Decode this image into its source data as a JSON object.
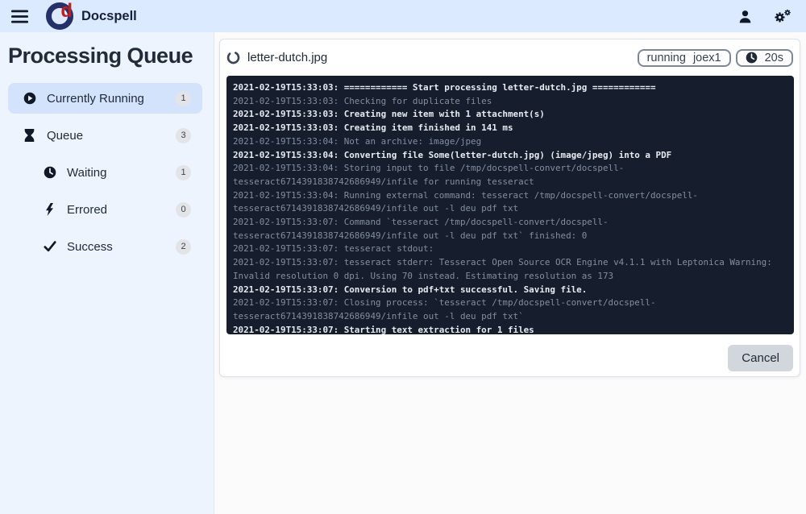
{
  "navbar": {
    "brand": "Docspell",
    "logo_letter": "d",
    "icons": [
      "menu-icon",
      "user-icon",
      "cogs-icon"
    ]
  },
  "sidebar": {
    "title": "Processing Queue",
    "items": [
      {
        "label": "Currently Running",
        "count": "1",
        "icon": "play-circle-icon",
        "active": true,
        "indent": false
      },
      {
        "label": "Queue",
        "count": "3",
        "icon": "hourglass-icon",
        "active": false,
        "indent": false
      },
      {
        "label": "Waiting",
        "count": "1",
        "icon": "clock-icon",
        "active": false,
        "indent": true
      },
      {
        "label": "Errored",
        "count": "0",
        "icon": "bolt-icon",
        "active": false,
        "indent": true
      },
      {
        "label": "Success",
        "count": "2",
        "icon": "check-icon",
        "active": false,
        "indent": true
      }
    ]
  },
  "job_card": {
    "title": "letter-dutch.jpg",
    "title_icon": "circle-notch-spinner-icon",
    "state_badge": {
      "state": "running",
      "worker": "joex1"
    },
    "duration_badge": "20s",
    "duration_icon": "clock-icon",
    "cancel_label": "Cancel"
  },
  "console": {
    "lines": [
      {
        "level": "info",
        "text": "2021-02-19T15:33:03: ============ Start processing letter-dutch.jpg ============"
      },
      {
        "level": "debug",
        "text": "2021-02-19T15:33:03: Checking for duplicate files"
      },
      {
        "level": "info",
        "text": "2021-02-19T15:33:03: Creating new item with 1 attachment(s)"
      },
      {
        "level": "info",
        "text": "2021-02-19T15:33:03: Creating item finished in 141 ms"
      },
      {
        "level": "debug",
        "text": "2021-02-19T15:33:04: Not an archive: image/jpeg"
      },
      {
        "level": "info",
        "text": "2021-02-19T15:33:04: Converting file Some(letter-dutch.jpg) (image/jpeg) into a PDF"
      },
      {
        "level": "debug",
        "text": "2021-02-19T15:33:04: Storing input to file /tmp/docspell-convert/docspell-tesseract6714391838742686949/infile for running tesseract"
      },
      {
        "level": "debug",
        "text": "2021-02-19T15:33:04: Running external command: tesseract /tmp/docspell-convert/docspell-tesseract6714391838742686949/infile out -l deu pdf txt"
      },
      {
        "level": "debug",
        "text": "2021-02-19T15:33:07: Command `tesseract /tmp/docspell-convert/docspell-tesseract6714391838742686949/infile out -l deu pdf txt` finished: 0"
      },
      {
        "level": "debug",
        "text": "2021-02-19T15:33:07: tesseract stdout:"
      },
      {
        "level": "debug",
        "text": "2021-02-19T15:33:07: tesseract stderr: Tesseract Open Source OCR Engine v4.1.1 with Leptonica Warning: Invalid resolution 0 dpi. Using 70 instead. Estimating resolution as 173"
      },
      {
        "level": "info",
        "text": "2021-02-19T15:33:07: Conversion to pdf+txt successful. Saving file."
      },
      {
        "level": "debug",
        "text": "2021-02-19T15:33:07: Closing process: `tesseract /tmp/docspell-convert/docspell-tesseract6714391838742686949/infile out -l deu pdf txt`"
      },
      {
        "level": "info",
        "text": "2021-02-19T15:33:07: Starting text extraction for 1 files"
      }
    ]
  },
  "colors": {
    "navbar_bg": "#dbeafe",
    "sidebar_bg": "#edf4fe",
    "active_item_bg": "#d3e3fb",
    "console_bg": "#161e2d",
    "log_info": "#e7ecf3",
    "log_debug": "#828e9f",
    "brand_navy": "#253069",
    "brand_red": "#bf1f23",
    "cancel_bg": "#d2d6dd"
  }
}
